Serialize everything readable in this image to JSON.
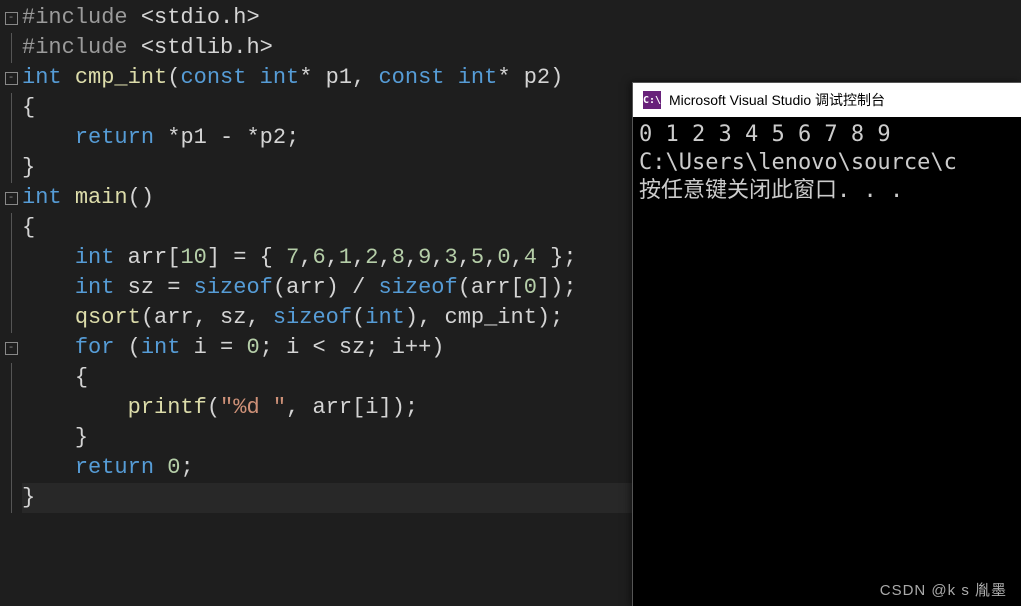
{
  "editor": {
    "lines": [
      {
        "fold": "minus",
        "tokens": [
          [
            "pp",
            "#include "
          ],
          [
            "op",
            "<"
          ],
          [
            "id",
            "stdio.h"
          ],
          [
            "op",
            ">"
          ]
        ]
      },
      {
        "fold": "line",
        "tokens": [
          [
            "pp",
            "#include "
          ],
          [
            "op",
            "<"
          ],
          [
            "id",
            "stdlib.h"
          ],
          [
            "op",
            ">"
          ]
        ]
      },
      {
        "fold": "minus",
        "tokens": [
          [
            "kw",
            "int"
          ],
          [
            "op",
            " "
          ],
          [
            "fn",
            "cmp_int"
          ],
          [
            "paren",
            "("
          ],
          [
            "kw",
            "const"
          ],
          [
            "op",
            " "
          ],
          [
            "kw",
            "int"
          ],
          [
            "op",
            "* "
          ],
          [
            "id",
            "p1"
          ],
          [
            "op",
            ", "
          ],
          [
            "kw",
            "const"
          ],
          [
            "op",
            " "
          ],
          [
            "kw",
            "int"
          ],
          [
            "op",
            "* "
          ],
          [
            "id",
            "p2"
          ],
          [
            "paren",
            ")"
          ]
        ]
      },
      {
        "fold": "line",
        "tokens": [
          [
            "brace",
            "{"
          ]
        ]
      },
      {
        "fold": "line",
        "tokens": [
          [
            "op",
            "    "
          ],
          [
            "kw",
            "return"
          ],
          [
            "op",
            " *"
          ],
          [
            "id",
            "p1"
          ],
          [
            "op",
            " - *"
          ],
          [
            "id",
            "p2"
          ],
          [
            "op",
            ";"
          ]
        ]
      },
      {
        "fold": "line",
        "tokens": [
          [
            "brace",
            "}"
          ]
        ]
      },
      {
        "fold": "minus",
        "tokens": [
          [
            "kw",
            "int"
          ],
          [
            "op",
            " "
          ],
          [
            "fn",
            "main"
          ],
          [
            "paren",
            "()"
          ]
        ]
      },
      {
        "fold": "line",
        "tokens": [
          [
            "brace",
            "{"
          ]
        ]
      },
      {
        "fold": "line",
        "tokens": [
          [
            "op",
            "    "
          ],
          [
            "kw",
            "int"
          ],
          [
            "op",
            " "
          ],
          [
            "id",
            "arr"
          ],
          [
            "op",
            "["
          ],
          [
            "num",
            "10"
          ],
          [
            "op",
            "] = { "
          ],
          [
            "num",
            "7"
          ],
          [
            "op",
            ","
          ],
          [
            "num",
            "6"
          ],
          [
            "op",
            ","
          ],
          [
            "num",
            "1"
          ],
          [
            "op",
            ","
          ],
          [
            "num",
            "2"
          ],
          [
            "op",
            ","
          ],
          [
            "num",
            "8"
          ],
          [
            "op",
            ","
          ],
          [
            "num",
            "9"
          ],
          [
            "op",
            ","
          ],
          [
            "num",
            "3"
          ],
          [
            "op",
            ","
          ],
          [
            "num",
            "5"
          ],
          [
            "op",
            ","
          ],
          [
            "num",
            "0"
          ],
          [
            "op",
            ","
          ],
          [
            "num",
            "4"
          ],
          [
            "op",
            " };"
          ]
        ]
      },
      {
        "fold": "line",
        "tokens": [
          [
            "op",
            "    "
          ],
          [
            "kw",
            "int"
          ],
          [
            "op",
            " "
          ],
          [
            "id",
            "sz"
          ],
          [
            "op",
            " = "
          ],
          [
            "kw",
            "sizeof"
          ],
          [
            "paren",
            "("
          ],
          [
            "id",
            "arr"
          ],
          [
            "paren",
            ")"
          ],
          [
            "op",
            " / "
          ],
          [
            "kw",
            "sizeof"
          ],
          [
            "paren",
            "("
          ],
          [
            "id",
            "arr"
          ],
          [
            "op",
            "["
          ],
          [
            "num",
            "0"
          ],
          [
            "op",
            "]"
          ],
          [
            "paren",
            ")"
          ],
          [
            "op",
            ";"
          ]
        ]
      },
      {
        "fold": "line",
        "tokens": [
          [
            "op",
            "    "
          ],
          [
            "fn",
            "qsort"
          ],
          [
            "paren",
            "("
          ],
          [
            "id",
            "arr"
          ],
          [
            "op",
            ", "
          ],
          [
            "id",
            "sz"
          ],
          [
            "op",
            ", "
          ],
          [
            "kw",
            "sizeof"
          ],
          [
            "paren",
            "("
          ],
          [
            "kw",
            "int"
          ],
          [
            "paren",
            ")"
          ],
          [
            "op",
            ", "
          ],
          [
            "id",
            "cmp_int"
          ],
          [
            "paren",
            ")"
          ],
          [
            "op",
            ";"
          ]
        ]
      },
      {
        "fold": "minus",
        "tokens": [
          [
            "op",
            "    "
          ],
          [
            "kw",
            "for"
          ],
          [
            "op",
            " "
          ],
          [
            "paren",
            "("
          ],
          [
            "kw",
            "int"
          ],
          [
            "op",
            " "
          ],
          [
            "id",
            "i"
          ],
          [
            "op",
            " = "
          ],
          [
            "num",
            "0"
          ],
          [
            "op",
            "; "
          ],
          [
            "id",
            "i"
          ],
          [
            "op",
            " < "
          ],
          [
            "id",
            "sz"
          ],
          [
            "op",
            "; "
          ],
          [
            "id",
            "i"
          ],
          [
            "op",
            "++"
          ],
          [
            "paren",
            ")"
          ]
        ]
      },
      {
        "fold": "line",
        "tokens": [
          [
            "op",
            "    "
          ],
          [
            "brace",
            "{"
          ]
        ]
      },
      {
        "fold": "line",
        "tokens": [
          [
            "op",
            "        "
          ],
          [
            "fn",
            "printf"
          ],
          [
            "paren",
            "("
          ],
          [
            "str",
            "\"%d \""
          ],
          [
            "op",
            ", "
          ],
          [
            "id",
            "arr"
          ],
          [
            "op",
            "["
          ],
          [
            "id",
            "i"
          ],
          [
            "op",
            "]"
          ],
          [
            "paren",
            ")"
          ],
          [
            "op",
            ";"
          ]
        ]
      },
      {
        "fold": "line",
        "tokens": [
          [
            "op",
            "    "
          ],
          [
            "brace",
            "}"
          ]
        ]
      },
      {
        "fold": "line",
        "tokens": [
          [
            "op",
            "    "
          ],
          [
            "kw",
            "return"
          ],
          [
            "op",
            " "
          ],
          [
            "num",
            "0"
          ],
          [
            "op",
            ";"
          ]
        ]
      },
      {
        "fold": "line",
        "current": true,
        "tokens": [
          [
            "brace",
            "}"
          ]
        ]
      }
    ]
  },
  "console": {
    "icon_text": "C:\\",
    "title": "Microsoft Visual Studio 调试控制台",
    "lines": [
      "0 1 2 3 4 5 6 7 8 9",
      "C:\\Users\\lenovo\\source\\c",
      "按任意键关闭此窗口. . ."
    ]
  },
  "watermark": "CSDN @k  s 胤墨"
}
